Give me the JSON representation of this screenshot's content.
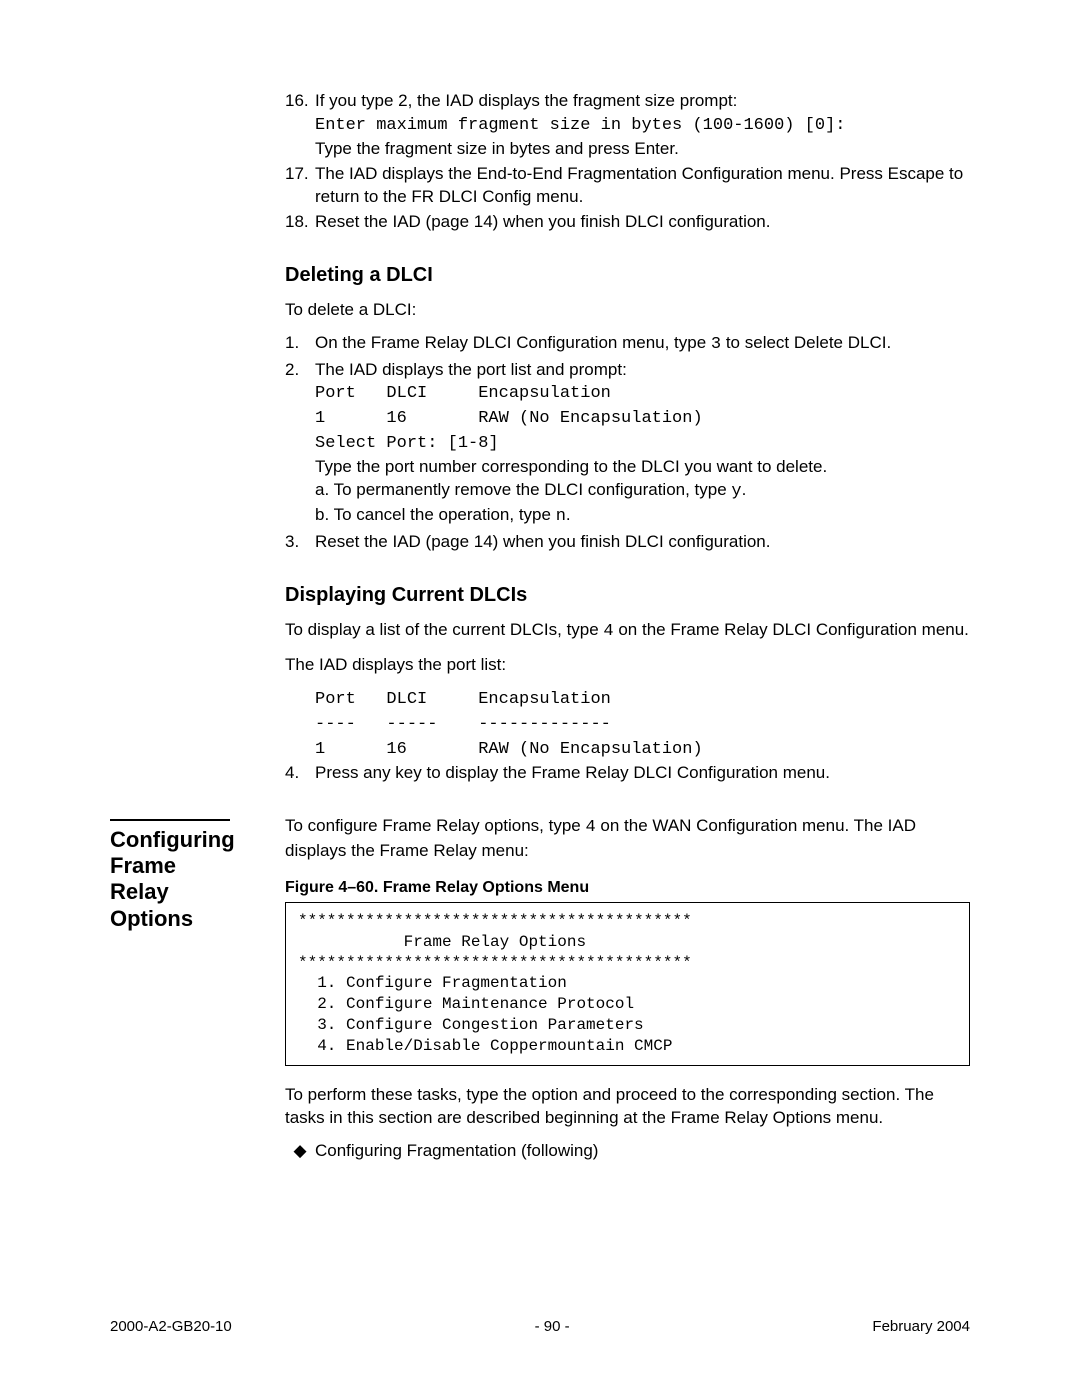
{
  "step16": {
    "num": "16.",
    "line1": "If you type 2, the IAD displays the fragment size prompt:",
    "code": "Enter maximum fragment size in bytes (100-1600) [0]:",
    "line2": "Type the fragment size in bytes and press Enter."
  },
  "step17": {
    "num": "17.",
    "text": "The IAD displays the End-to-End Fragmentation Configuration menu. Press Escape to return to the FR DLCI Config menu."
  },
  "step18": {
    "num": "18.",
    "text": "Reset the IAD (page 14) when you finish DLCI configuration."
  },
  "delete": {
    "heading": "Deleting a DLCI",
    "intro": "To delete a DLCI:",
    "s1": {
      "num": "1.",
      "pre": "On the Frame Relay DLCI Configuration menu, type ",
      "code": "3",
      "post": " to select Delete DLCI."
    },
    "s2": {
      "num": "2.",
      "line1": "The IAD displays the port list and prompt:",
      "code": "Port   DLCI     Encapsulation\n1      16       RAW (No Encapsulation)\nSelect Port: [1-8]",
      "line2": "Type the port number corresponding to the DLCI you want to delete.",
      "a_pre": "a. To permanently remove the DLCI configuration, type ",
      "a_code": "y",
      "a_post": ".",
      "b_pre": "b. To cancel the operation, type ",
      "b_code": "n",
      "b_post": "."
    },
    "s3": {
      "num": "3.",
      "text": "Reset the IAD (page 14) when you finish DLCI configuration."
    }
  },
  "display": {
    "heading": "Displaying Current DLCIs",
    "p1_pre": "To display a list of the current DLCIs, type ",
    "p1_code": "4",
    "p1_post": " on the Frame Relay DLCI Configuration menu.",
    "p2": "The IAD displays the port list:",
    "code": "Port   DLCI     Encapsulation\n----   -----    -------------\n1      16       RAW (No Encapsulation)",
    "s4": {
      "num": "4.",
      "text": "Press any key to display the Frame Relay DLCI Configuration menu."
    }
  },
  "configure": {
    "sidebar": "Configuring Frame Relay Options",
    "intro_pre": "To configure Frame Relay options, type ",
    "intro_code": "4",
    "intro_post": " on the WAN Configuration menu. The IAD displays the Frame Relay menu:",
    "fig_caption": "Figure 4–60.  Frame Relay Options Menu",
    "menu": "*****************************************\n           Frame Relay Options\n*****************************************\n  1. Configure Fragmentation\n  2. Configure Maintenance Protocol\n  3. Configure Congestion Parameters\n  4. Enable/Disable Coppermountain CMCP",
    "after": "To perform these tasks, type the option and proceed to the corresponding section. The tasks in this section are described beginning at the Frame Relay Options menu.",
    "bullet": "Configuring Fragmentation (following)"
  },
  "footer": {
    "left": "2000-A2-GB20-10",
    "center": "- 90 -",
    "right": "February 2004"
  }
}
